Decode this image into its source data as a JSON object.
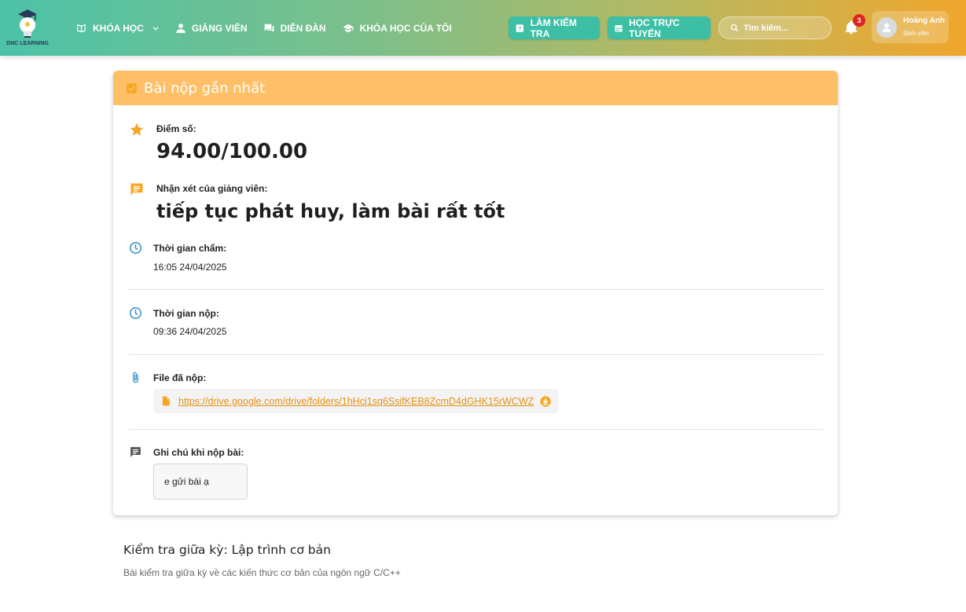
{
  "header": {
    "logo_text": "DNC LEARNING",
    "nav": [
      {
        "label": "KHÓA HỌC"
      },
      {
        "label": "GIẢNG VIÊN"
      },
      {
        "label": "DIỄN ĐÀN"
      },
      {
        "label": "KHÓA HỌC CỦA TÔI"
      }
    ],
    "btn_test_label": "LÀM KIỂM TRA",
    "btn_online_label": "HỌC TRỰC TUYẾN",
    "search_placeholder": "Tìm kiếm...",
    "notification_count": "3",
    "user_name": "Hoàng Anh",
    "user_role": "Sinh viên"
  },
  "card": {
    "title": "Bài nộp gần nhất",
    "score_label": "Điểm số:",
    "score_value": "94.00/100.00",
    "comment_label": "Nhận xét của giảng viên:",
    "comment_value": "tiếp tục phát huy, làm bài rất tốt",
    "graded_time_label": "Thời gian chấm:",
    "graded_time_value": "16:05 24/04/2025",
    "submit_time_label": "Thời gian nộp:",
    "submit_time_value": "09:36 24/04/2025",
    "file_label": "File đã nộp:",
    "file_url": "https://drive.google.com/drive/folders/1hHcj1sq6SsifKEB8ZcmD4dGHK15rWCWZ",
    "note_label": "Ghi chú khi nộp bài:",
    "note_value": "e gửi bài ạ"
  },
  "exam": {
    "title": "Kiểm tra giữa kỳ: Lập trình cơ bản",
    "description": "Bài kiểm tra giữa kỳ về các kiến thức cơ bản của ngôn ngữ C/C++"
  },
  "colors": {
    "accent_orange": "#f5a623",
    "card_header": "#ffbf66",
    "teal_button": "#3cbfa5",
    "icon_blue": "#2a86c7"
  }
}
